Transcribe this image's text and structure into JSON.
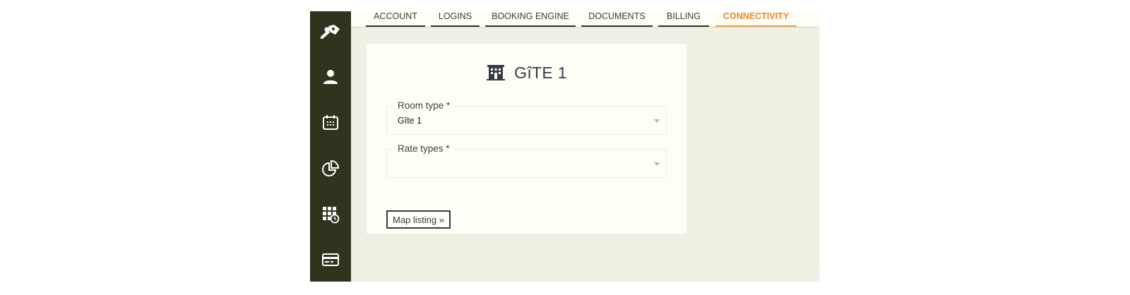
{
  "sidebar": {
    "items": [
      {
        "icon": "keys-icon"
      },
      {
        "icon": "user-icon"
      },
      {
        "icon": "calendar-icon"
      },
      {
        "icon": "pie-chart-icon"
      },
      {
        "icon": "grid-clock-icon"
      },
      {
        "icon": "credit-card-icon"
      }
    ]
  },
  "tabs": [
    {
      "label": "ACCOUNT"
    },
    {
      "label": "LOGINS"
    },
    {
      "label": "BOOKING ENGINE"
    },
    {
      "label": "DOCUMENTS"
    },
    {
      "label": "BILLING"
    },
    {
      "label": "CONNECTIVITY",
      "active": true
    }
  ],
  "card": {
    "icon": "building-icon",
    "title": "GîTE 1",
    "fields": [
      {
        "label": "Room type *",
        "value": "Gîte 1"
      },
      {
        "label": "Rate types *",
        "value": ""
      }
    ],
    "button_label": "Map listing »"
  },
  "colors": {
    "sidebar_bg": "#30341f",
    "page_bg": "#edf1e4",
    "card_bg": "#fffef6",
    "accent": "#e8892b",
    "text_dark": "#363a48"
  }
}
